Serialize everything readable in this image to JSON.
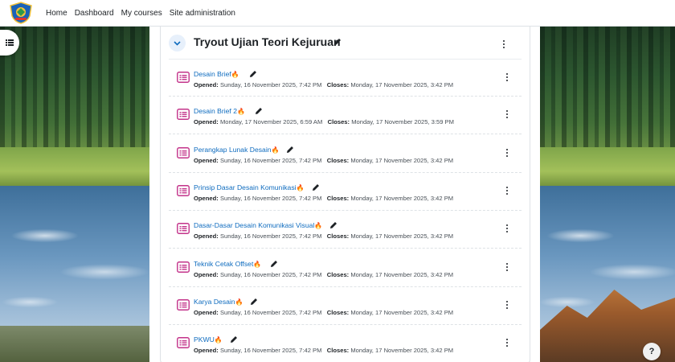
{
  "navbar": {
    "logo_icon": "school-crest-logo",
    "links": [
      "Home",
      "Dashboard",
      "My courses",
      "Site administration"
    ]
  },
  "drawer": {
    "icon": "list-icon"
  },
  "section": {
    "title": "Tryout Ujian Teori Kejuruan",
    "accent_color": "#0f6cbf"
  },
  "labels": {
    "opened": "Opened:",
    "closes": "Closes:"
  },
  "activities": [
    {
      "name": "Desain Brief",
      "opened": "Sunday, 16 November 2025, 7:42 PM",
      "closes": "Monday, 17 November 2025, 3:42 PM"
    },
    {
      "name": "Desain Brief 2",
      "opened": "Monday, 17 November 2025, 6:59 AM",
      "closes": "Monday, 17 November 2025, 3:59 PM"
    },
    {
      "name": "Perangkap Lunak Desain",
      "opened": "Sunday, 16 November 2025, 7:42 PM",
      "closes": "Monday, 17 November 2025, 3:42 PM"
    },
    {
      "name": "Prinsip Dasar Desain Komunikasi",
      "opened": "Sunday, 16 November 2025, 7:42 PM",
      "closes": "Monday, 17 November 2025, 3:42 PM"
    },
    {
      "name": "Dasar-Dasar Desain Komunikasi Visual",
      "opened": "Sunday, 16 November 2025, 7:42 PM",
      "closes": "Monday, 17 November 2025, 3:42 PM"
    },
    {
      "name": "Teknik Cetak Offset",
      "opened": "Sunday, 16 November 2025, 7:42 PM",
      "closes": "Monday, 17 November 2025, 3:42 PM"
    },
    {
      "name": "Karya Desain",
      "opened": "Sunday, 16 November 2025, 7:42 PM",
      "closes": "Monday, 17 November 2025, 3:42 PM"
    },
    {
      "name": "PKWU",
      "opened": "Sunday, 16 November 2025, 7:42 PM",
      "closes": "Monday, 17 November 2025, 3:42 PM"
    }
  ],
  "help": {
    "label": "?"
  }
}
